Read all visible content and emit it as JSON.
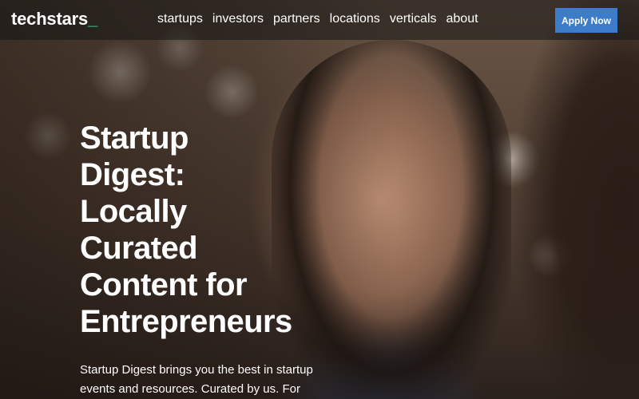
{
  "header": {
    "logo_text": "techstars",
    "logo_underscore": "_",
    "nav": [
      "startups",
      "investors",
      "partners",
      "locations",
      "verticals",
      "about"
    ],
    "apply_label": "Apply Now"
  },
  "hero": {
    "title_lines": [
      "Startup",
      "Digest:",
      "Locally",
      "Curated",
      "Content for",
      "Entrepreneurs"
    ],
    "description": "Startup Digest brings you the best in startup events and resources. Curated by us. For"
  },
  "colors": {
    "accent": "#3d7cc9",
    "logo_accent": "#3ddc97"
  }
}
